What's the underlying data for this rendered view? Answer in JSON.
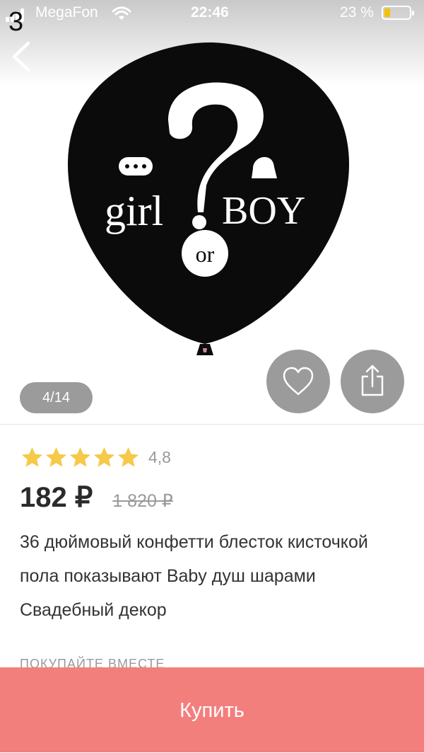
{
  "status_bar": {
    "carrier": "MegaFon",
    "time": "22:46",
    "battery_percent": "23 %",
    "battery_level": 0.23
  },
  "page_counter": "3",
  "gallery": {
    "counter": "4/14"
  },
  "product": {
    "rating_value": "4,8",
    "stars": 5,
    "price": "182 ₽",
    "old_price": "1 820 ₽",
    "title": "36 дюймовый конфетти блесток кисточкой пола показывают Baby душ шарами Свадебный декор",
    "image_text": {
      "girl": "girl",
      "or": "or",
      "boy": "BOY"
    }
  },
  "sections": {
    "together_heading": "ПОКУПАЙТЕ ВМЕСТЕ"
  },
  "buy_button": "Купить",
  "colors": {
    "star": "#f5c94a",
    "buy_button": "#f37f7d",
    "overlay_button": "#9b9b9b",
    "battery_fill": "#f2c200"
  }
}
